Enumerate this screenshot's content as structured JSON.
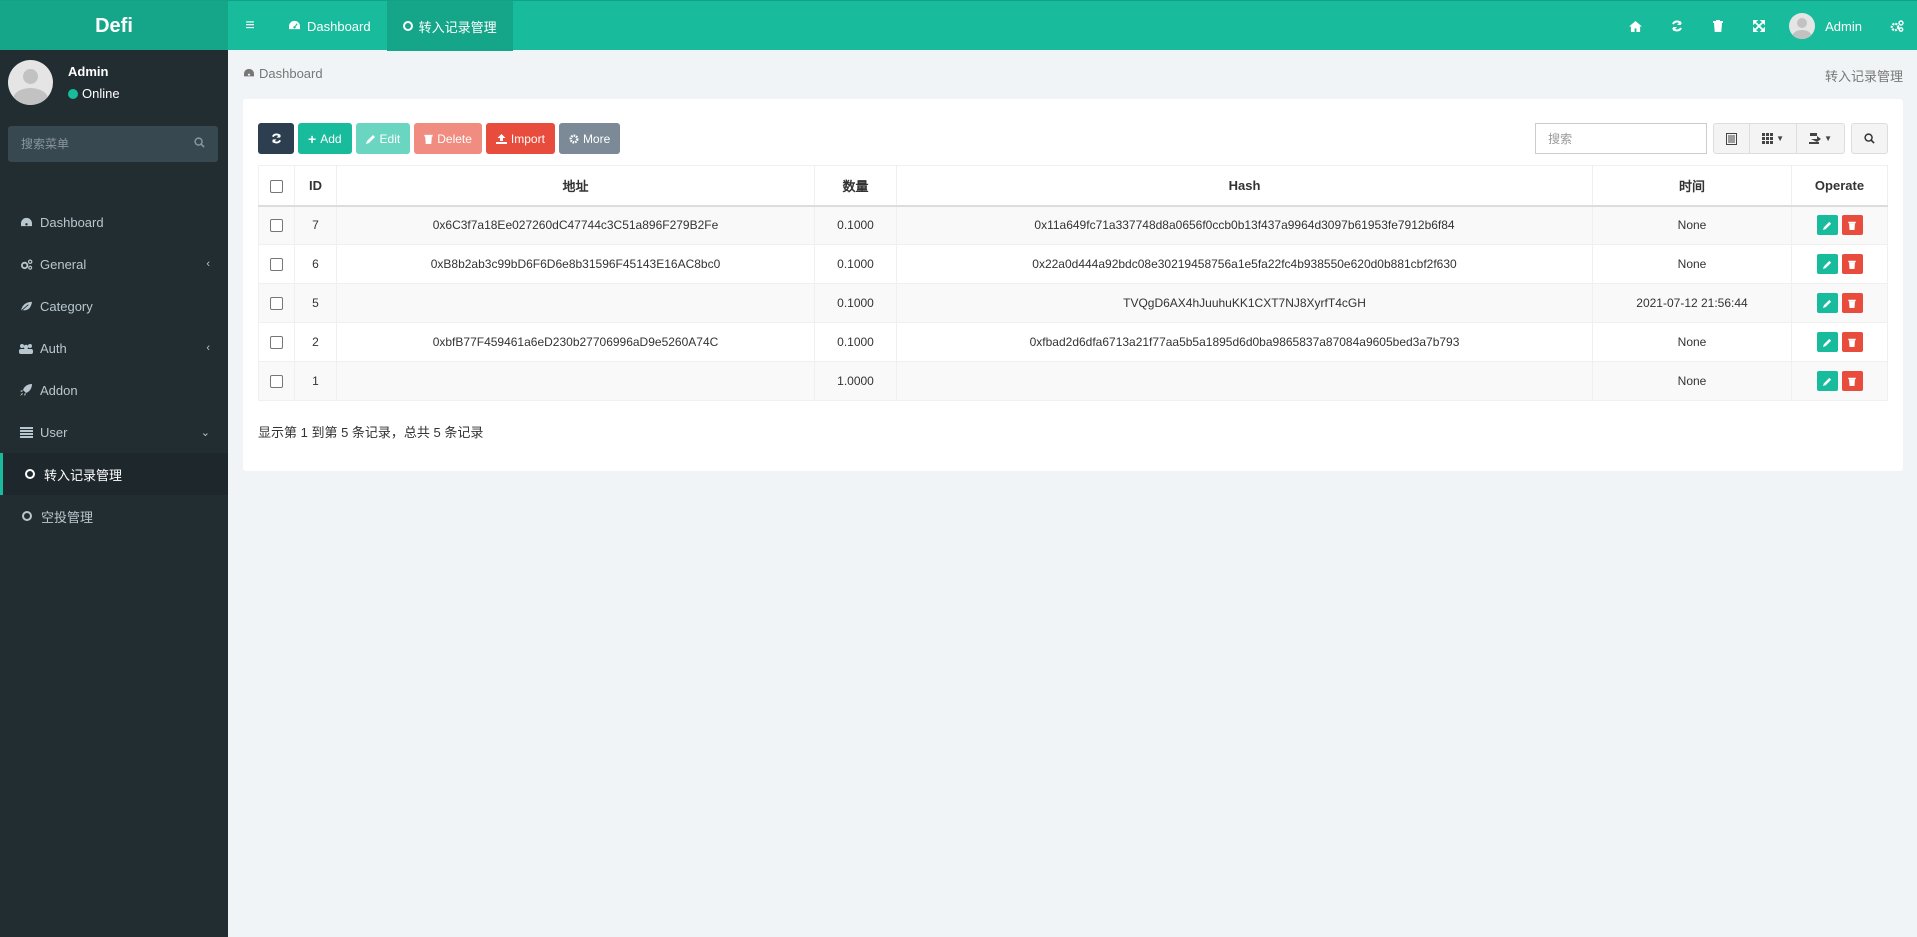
{
  "app": {
    "logo": "Defi"
  },
  "topnav": {
    "tabs": [
      {
        "label": "Dashboard",
        "icon": "dashboard-icon"
      },
      {
        "label": "转入记录管理",
        "icon": "circle-icon"
      }
    ],
    "user_name": "Admin"
  },
  "sidebar": {
    "user_name": "Admin",
    "status": "Online",
    "search_placeholder": "搜索菜单",
    "items": [
      {
        "label": "Dashboard",
        "icon": "dashboard-icon"
      },
      {
        "label": "General",
        "icon": "cogs-icon",
        "arrow": "‹"
      },
      {
        "label": "Category",
        "icon": "leaf-icon"
      },
      {
        "label": "Auth",
        "icon": "group-icon",
        "arrow": "‹"
      },
      {
        "label": "Addon",
        "icon": "rocket-icon"
      },
      {
        "label": "User",
        "icon": "list-icon",
        "arrow": "⌄"
      },
      {
        "label": "转入记录管理",
        "icon": "circle-icon",
        "active": true
      },
      {
        "label": "空投管理",
        "icon": "circle-icon"
      }
    ]
  },
  "breadcrumb": {
    "left": "Dashboard",
    "right": "转入记录管理"
  },
  "toolbar": {
    "add": "Add",
    "edit": "Edit",
    "delete": "Delete",
    "import": "Import",
    "more": "More",
    "search_placeholder": "搜索"
  },
  "table": {
    "columns": [
      "ID",
      "地址",
      "数量",
      "Hash",
      "时间",
      "Operate"
    ],
    "rows": [
      {
        "id": "7",
        "address": "0x6C3f7a18Ee027260dC47744c3C51a896F279B2Fe",
        "amount": "0.1000",
        "hash": "0x11a649fc71a337748d8a0656f0ccb0b13f437a9964d3097b61953fe7912b6f84",
        "time": "None"
      },
      {
        "id": "6",
        "address": "0xB8b2ab3c99bD6F6D6e8b31596F45143E16AC8bc0",
        "amount": "0.1000",
        "hash": "0x22a0d444a92bdc08e30219458756a1e5fa22fc4b938550e620d0b881cbf2f630",
        "time": "None"
      },
      {
        "id": "5",
        "address": "",
        "amount": "0.1000",
        "hash": "TVQgD6AX4hJuuhuKK1CXT7NJ8XyrfT4cGH",
        "time": "2021-07-12 21:56:44"
      },
      {
        "id": "2",
        "address": "0xbfB77F459461a6eD230b27706996aD9e5260A74C",
        "amount": "0.1000",
        "hash": "0xfbad2d6dfa6713a21f77aa5b5a1895d6d0ba9865837a87084a9605bed3a7b793",
        "time": "None"
      },
      {
        "id": "1",
        "address": "",
        "amount": "1.0000",
        "hash": "",
        "time": "None"
      }
    ]
  },
  "pagination": {
    "info": "显示第 1 到第 5 条记录，总共 5 条记录"
  },
  "colors": {
    "primary": "#18bc9c",
    "sidebar": "#222d32",
    "danger": "#e74c3c",
    "dark": "#2c3e50"
  }
}
